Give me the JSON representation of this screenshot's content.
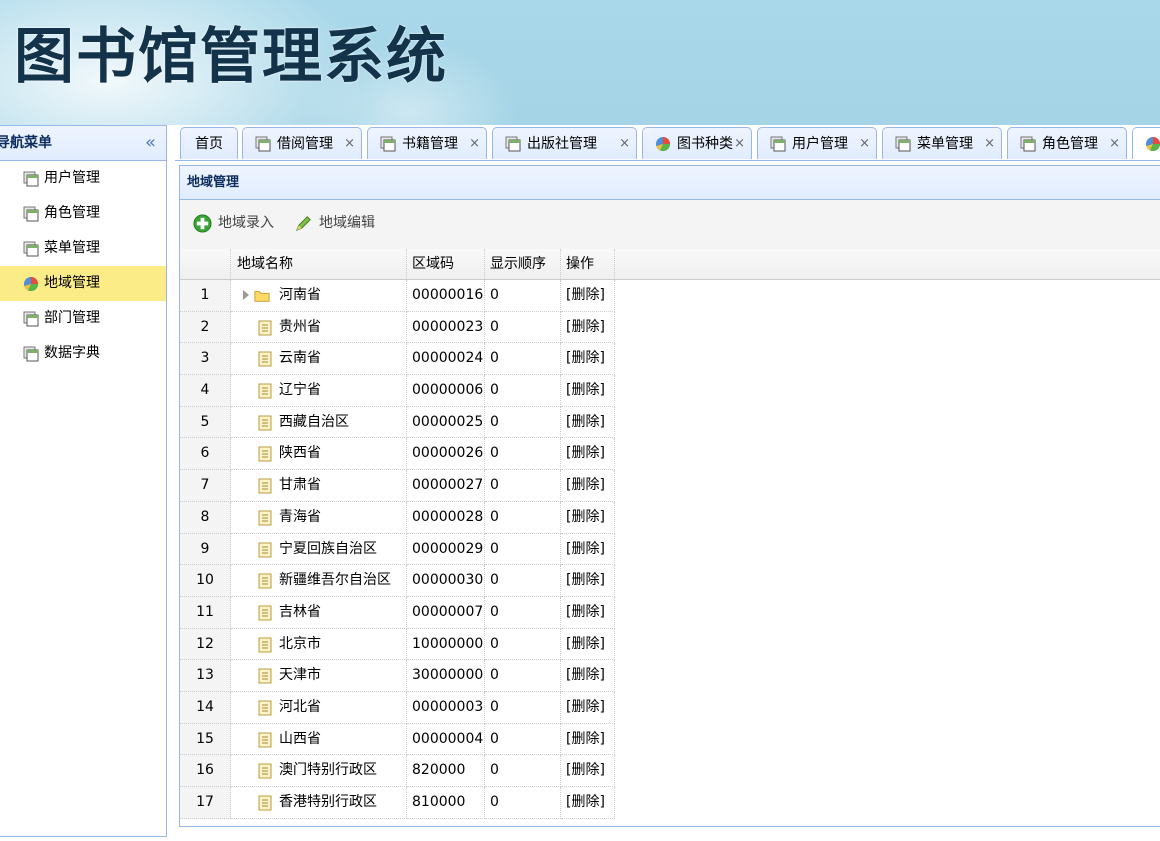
{
  "header": {
    "title": "图书馆管理系统"
  },
  "nav": {
    "title": "导航菜单",
    "collapse_glyph": "«",
    "items": [
      {
        "label": "用户管理",
        "icon": "window-icon",
        "active": false
      },
      {
        "label": "角色管理",
        "icon": "window-icon",
        "active": false
      },
      {
        "label": "菜单管理",
        "icon": "window-icon",
        "active": false
      },
      {
        "label": "地域管理",
        "icon": "pie-chart-icon",
        "active": true
      },
      {
        "label": "部门管理",
        "icon": "window-icon",
        "active": false
      },
      {
        "label": "数据字典",
        "icon": "window-icon",
        "active": false
      }
    ]
  },
  "tabs": [
    {
      "label": "首页"
    },
    {
      "label": "借阅管理",
      "close": "×"
    },
    {
      "label": "书籍管理",
      "close": "×"
    },
    {
      "label": "出版社管理",
      "close": "×"
    },
    {
      "label": "图书种类",
      "close": "×"
    },
    {
      "label": "用户管理",
      "close": "×"
    },
    {
      "label": "菜单管理",
      "close": "×"
    },
    {
      "label": "角色管理",
      "close": "×"
    }
  ],
  "panel": {
    "title": "地域管理",
    "toolbar": {
      "add_label": "地域录入",
      "edit_label": "地域编辑"
    },
    "columns": {
      "name": "地域名称",
      "code": "区域码",
      "order": "显示顺序",
      "op": "操作"
    },
    "rows": [
      {
        "num": "1",
        "name": "河南省",
        "code": "00000016",
        "order": "0",
        "op": "[删除]",
        "folder": true
      },
      {
        "num": "2",
        "name": "贵州省",
        "code": "00000023",
        "order": "0",
        "op": "[删除]"
      },
      {
        "num": "3",
        "name": "云南省",
        "code": "00000024",
        "order": "0",
        "op": "[删除]"
      },
      {
        "num": "4",
        "name": "辽宁省",
        "code": "00000006",
        "order": "0",
        "op": "[删除]"
      },
      {
        "num": "5",
        "name": "西藏自治区",
        "code": "00000025",
        "order": "0",
        "op": "[删除]"
      },
      {
        "num": "6",
        "name": "陕西省",
        "code": "00000026",
        "order": "0",
        "op": "[删除]"
      },
      {
        "num": "7",
        "name": "甘肃省",
        "code": "00000027",
        "order": "0",
        "op": "[删除]"
      },
      {
        "num": "8",
        "name": "青海省",
        "code": "00000028",
        "order": "0",
        "op": "[删除]"
      },
      {
        "num": "9",
        "name": "宁夏回族自治区",
        "code": "00000029",
        "order": "0",
        "op": "[删除]"
      },
      {
        "num": "10",
        "name": "新疆维吾尔自治区",
        "code": "00000030",
        "order": "0",
        "op": "[删除]"
      },
      {
        "num": "11",
        "name": "吉林省",
        "code": "00000007",
        "order": "0",
        "op": "[删除]"
      },
      {
        "num": "12",
        "name": "北京市",
        "code": "10000000",
        "order": "0",
        "op": "[删除]"
      },
      {
        "num": "13",
        "name": "天津市",
        "code": "30000000",
        "order": "0",
        "op": "[删除]"
      },
      {
        "num": "14",
        "name": "河北省",
        "code": "00000003",
        "order": "0",
        "op": "[删除]"
      },
      {
        "num": "15",
        "name": "山西省",
        "code": "00000004",
        "order": "0",
        "op": "[删除]"
      },
      {
        "num": "16",
        "name": "澳门特别行政区",
        "code": "820000",
        "order": "0",
        "op": "[删除]"
      },
      {
        "num": "17",
        "name": "香港特别行政区",
        "code": "810000",
        "order": "0",
        "op": "[删除]"
      }
    ]
  }
}
